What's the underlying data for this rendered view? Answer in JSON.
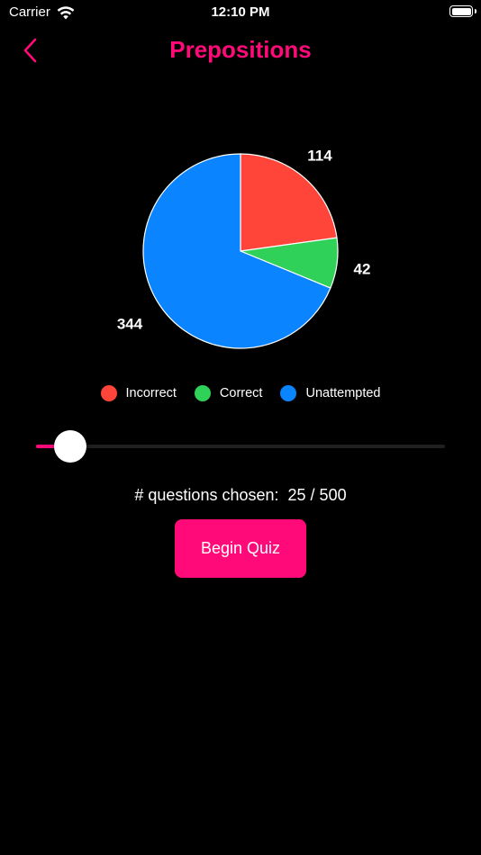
{
  "status_bar": {
    "carrier": "Carrier",
    "time": "12:10 PM"
  },
  "nav": {
    "title": "Prepositions"
  },
  "chart_data": {
    "type": "pie",
    "slices": [
      {
        "name": "Incorrect",
        "value": 114,
        "color": "#ff453a"
      },
      {
        "name": "Correct",
        "value": 42,
        "color": "#30d158"
      },
      {
        "name": "Unattempted",
        "value": 344,
        "color": "#0a84ff"
      }
    ]
  },
  "legend": [
    {
      "label": "Incorrect",
      "color": "#ff453a"
    },
    {
      "label": "Correct",
      "color": "#30d158"
    },
    {
      "label": "Unattempted",
      "color": "#0a84ff"
    }
  ],
  "slider": {
    "value": 25,
    "max": 500,
    "fill_color": "#ff0a78"
  },
  "questions": {
    "label": "# questions chosen:",
    "value": "25 / 500"
  },
  "begin_button": {
    "label": "Begin Quiz"
  },
  "colors": {
    "accent": "#ff0a78",
    "background": "#000000"
  }
}
